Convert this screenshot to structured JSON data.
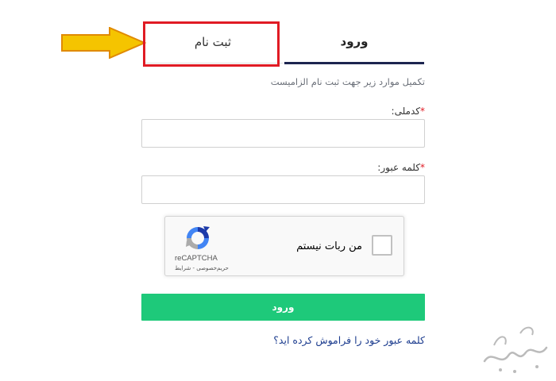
{
  "tabs": {
    "register_label": "ثبت نام",
    "login_label": "ورود"
  },
  "form": {
    "instruction": "تکمیل موارد زیر جهت ثبت نام الزامیست",
    "national_code_label": "کدملی:",
    "password_label": "کلمه عبور:",
    "required_mark": "*"
  },
  "captcha": {
    "checkbox_text": "من ربات نیستم",
    "brand": "reCAPTCHA",
    "terms": "حریم‌خصوصی - شرایط"
  },
  "actions": {
    "submit_label": "ورود",
    "forgot_password": "کلمه عبور خود را فراموش کرده اید؟"
  },
  "colors": {
    "accent_green": "#1ec97a",
    "highlight_red": "#e01b24",
    "arrow_yellow": "#f5c400",
    "tab_underline": "#1d2550",
    "link_blue": "#1d3d8f"
  },
  "icons": {
    "arrow": "pointer-arrow-icon",
    "recaptcha": "recaptcha-logo-icon",
    "watermark": "watermark-logo"
  }
}
